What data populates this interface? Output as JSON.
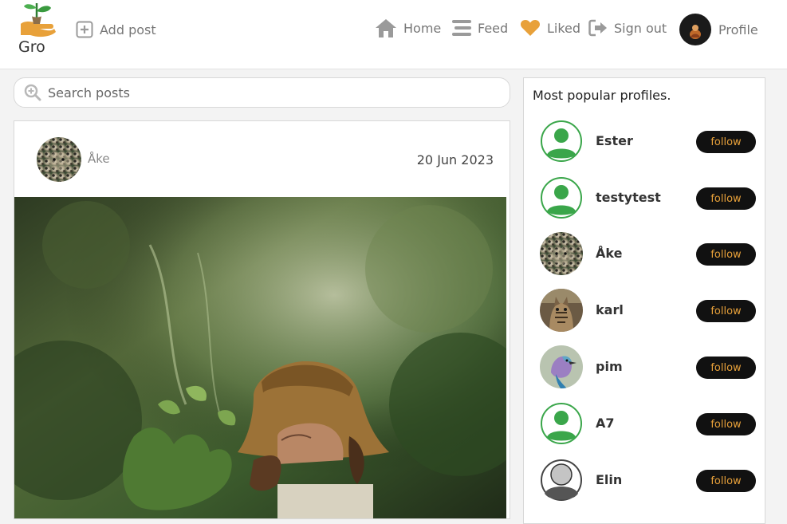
{
  "brand": {
    "name": "Gro",
    "logo_icon": "sprout-in-hand-icon",
    "accent": "#e8a13a",
    "green": "#3aa64a"
  },
  "nav": {
    "add_post": "Add post",
    "home": "Home",
    "feed": "Feed",
    "liked": "Liked",
    "sign_out": "Sign out",
    "profile": "Profile"
  },
  "search": {
    "placeholder": "Search posts",
    "value": ""
  },
  "post": {
    "username": "Åke",
    "date": "20 Jun 2023",
    "avatar": "leopard-photo",
    "image": "woman-in-sun-hat-with-plants-photo"
  },
  "sidebar": {
    "title": "Most popular profiles.",
    "follow_label": "follow",
    "profiles": [
      {
        "name": "Ester",
        "avatar": "default-user-icon"
      },
      {
        "name": "testytest",
        "avatar": "default-user-icon"
      },
      {
        "name": "Åke",
        "avatar": "leopard-photo"
      },
      {
        "name": "karl",
        "avatar": "tabby-cat-photo"
      },
      {
        "name": "pim",
        "avatar": "lilac-breasted-roller-photo"
      },
      {
        "name": "A7",
        "avatar": "default-user-icon"
      },
      {
        "name": "Elin",
        "avatar": "generic-user-silhouette-icon"
      }
    ]
  }
}
